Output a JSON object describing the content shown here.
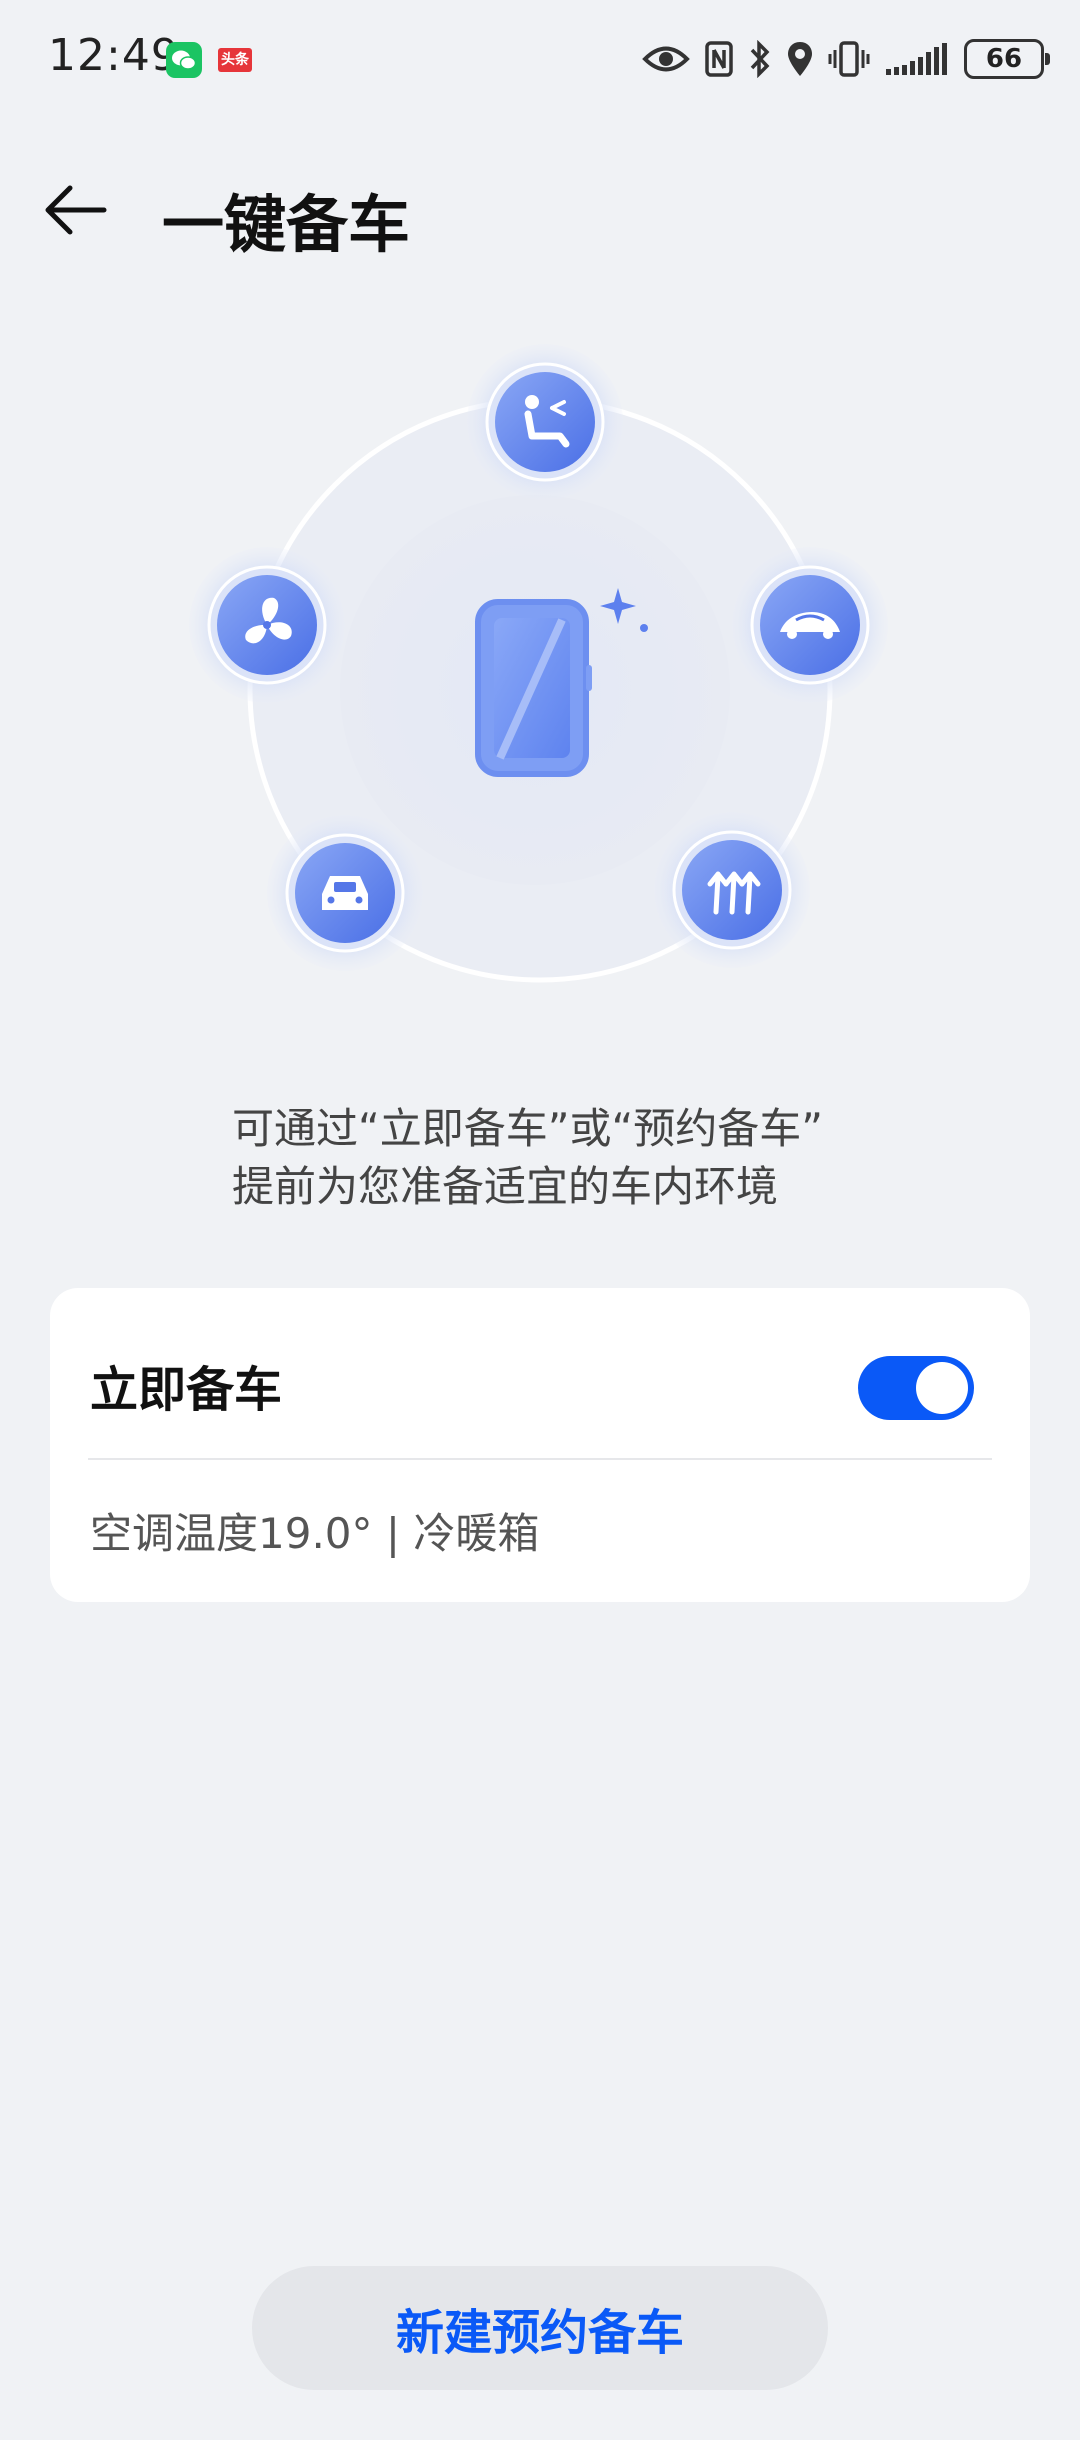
{
  "status_bar": {
    "time": "12:49",
    "app_badges": [
      "wechat-icon",
      "toutiao-icon"
    ],
    "toutiao_label": "头条",
    "icons": [
      "eye-icon",
      "nfc-icon",
      "bluetooth-icon",
      "location-icon",
      "vibrate-icon",
      "signal-icon"
    ],
    "battery": "66"
  },
  "header": {
    "back_icon": "arrow-left-icon",
    "title": "一键备车"
  },
  "illustration": {
    "center_icon": "phone-icon",
    "features": [
      "seat-icon",
      "fan-icon",
      "car-wash-icon",
      "car-icon",
      "defrost-icon"
    ]
  },
  "description": {
    "line1": "可通过“立即备车”或“预约备车”",
    "line2": "提前为您准备适宜的车内环境"
  },
  "card": {
    "title": "立即备车",
    "toggle_on": true,
    "subtitle": "空调温度19.0° | 冷暖箱"
  },
  "bottom_button": {
    "label": "新建预约备车"
  },
  "colors": {
    "accent": "#0a59f7",
    "background": "#f0f2f5",
    "card": "#ffffff"
  }
}
